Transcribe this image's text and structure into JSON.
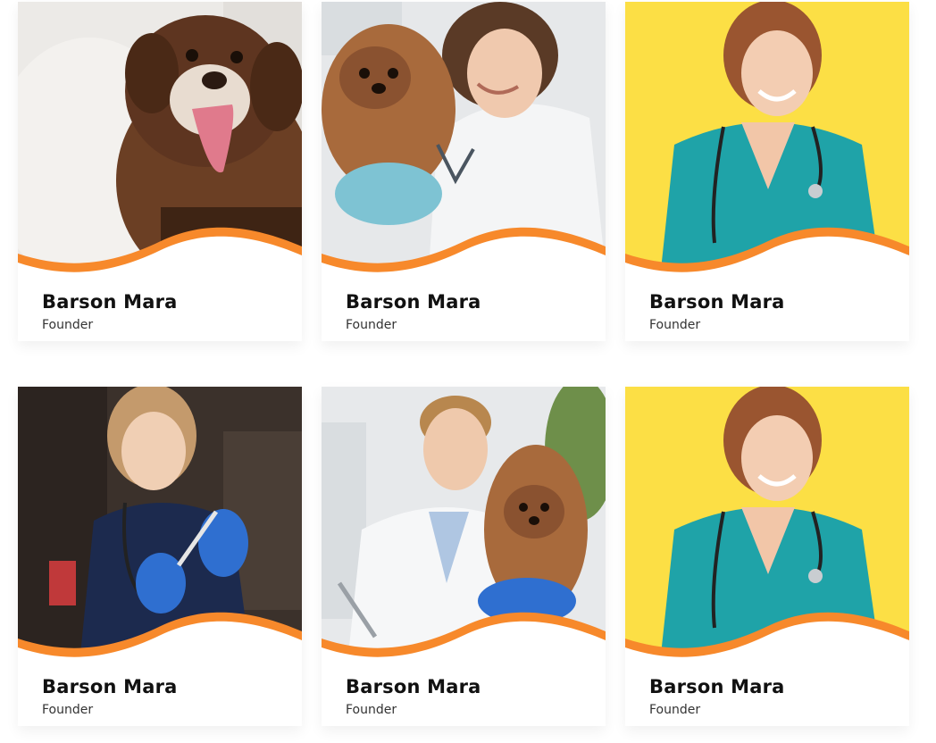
{
  "colors": {
    "accent": "#F7892B",
    "card_bg": "#FFFFFF",
    "name_text": "#111111",
    "role_text": "#333333"
  },
  "team": [
    {
      "name": "Barson Mara",
      "role": "Founder",
      "photo": "puppy-photo",
      "photo_bg": "#E9E6E2"
    },
    {
      "name": "Barson Mara",
      "role": "Founder",
      "photo": "vet-with-dog-photo",
      "photo_bg": "#E4E6E8"
    },
    {
      "name": "Barson Mara",
      "role": "Founder",
      "photo": "vet-yellow-bg-photo",
      "photo_bg": "#FCDF45"
    },
    {
      "name": "Barson Mara",
      "role": "Founder",
      "photo": "vet-syringe-photo",
      "photo_bg": "#3A302A"
    },
    {
      "name": "Barson Mara",
      "role": "Founder",
      "photo": "male-vet-with-dog-photo",
      "photo_bg": "#E6E8EA"
    },
    {
      "name": "Barson Mara",
      "role": "Founder",
      "photo": "vet-yellow-bg-photo",
      "photo_bg": "#FCDF45"
    }
  ]
}
